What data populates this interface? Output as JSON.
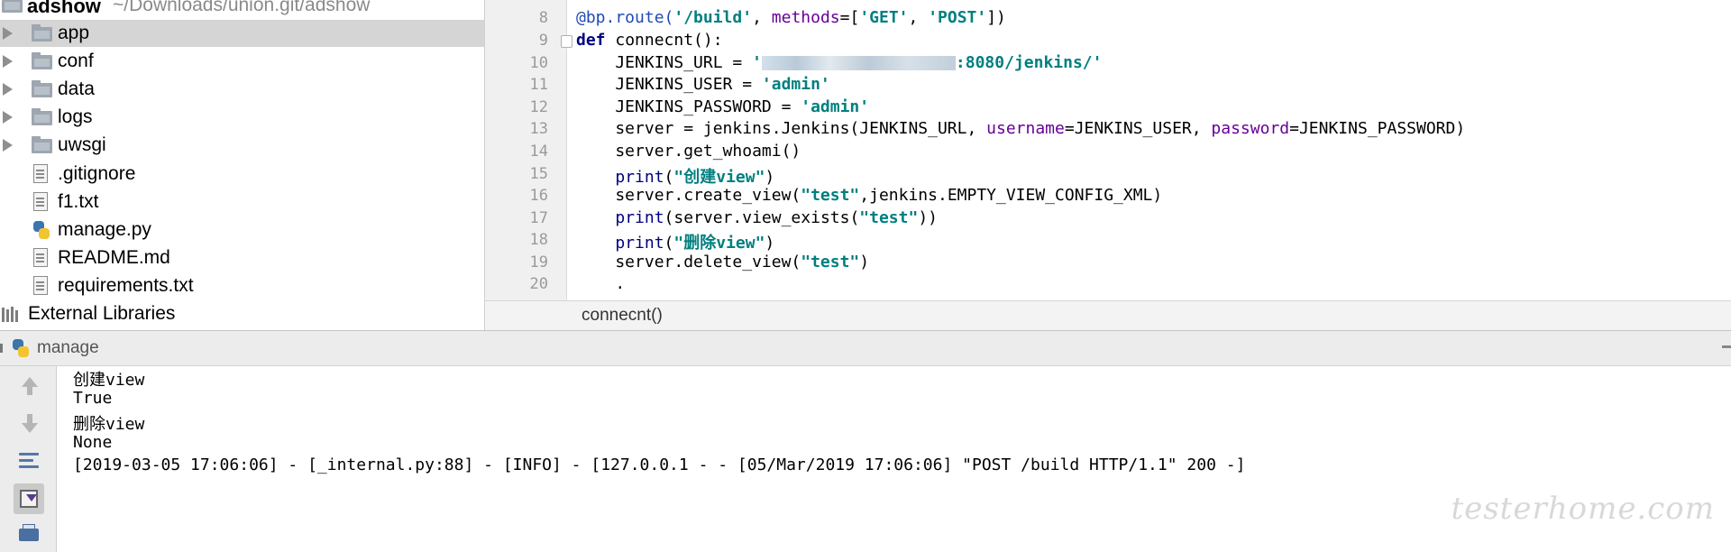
{
  "project": {
    "root_name": "adshow",
    "root_path": "~/Downloads/union.git/adshow",
    "items": [
      {
        "label": "app",
        "type": "folder",
        "selected": true
      },
      {
        "label": "conf",
        "type": "folder"
      },
      {
        "label": "data",
        "type": "folder"
      },
      {
        "label": "logs",
        "type": "folder"
      },
      {
        "label": "uwsgi",
        "type": "folder"
      },
      {
        "label": ".gitignore",
        "type": "file"
      },
      {
        "label": "f1.txt",
        "type": "file"
      },
      {
        "label": "manage.py",
        "type": "python-file"
      },
      {
        "label": "README.md",
        "type": "file"
      },
      {
        "label": "requirements.txt",
        "type": "file"
      }
    ],
    "external_libraries": "External Libraries"
  },
  "editor": {
    "line_numbers": [
      "8",
      "9",
      "10",
      "11",
      "12",
      "13",
      "14",
      "15",
      "16",
      "17",
      "18",
      "19",
      "20"
    ],
    "code": {
      "l8": {
        "a": "@bp.route(",
        "b": "'/build'",
        "c": ", ",
        "d": "methods",
        "e": "=[",
        "f": "'GET'",
        "g": ", ",
        "h": "'POST'",
        "i": "])"
      },
      "l9": {
        "kw": "def",
        "rest": " connecnt():"
      },
      "l10": {
        "a": "    JENKINS_URL = ",
        "q": "'",
        "tail": ":8080/jenkins/'"
      },
      "l11": {
        "a": "    JENKINS_USER = ",
        "s": "'admin'"
      },
      "l12": {
        "a": "    JENKINS_PASSWORD = ",
        "s": "'admin'"
      },
      "l13": {
        "a": "    server = jenkins.Jenkins(JENKINS_URL, ",
        "p1": "username",
        "b": "=JENKINS_USER, ",
        "p2": "password",
        "c": "=JENKINS_PASSWORD)"
      },
      "l14": {
        "a": "    server.get_whoami()"
      },
      "l15": {
        "a": "    ",
        "fn": "print",
        "b": "(",
        "s": "\"创建view\"",
        "c": ")"
      },
      "l16": {
        "a": "    server.create_view(",
        "s": "\"test\"",
        "b": ",jenkins.EMPTY_VIEW_CONFIG_XML)"
      },
      "l17": {
        "a": "    ",
        "fn": "print",
        "b": "(server.view_exists(",
        "s": "\"test\"",
        "c": "))"
      },
      "l18": {
        "a": "    ",
        "fn": "print",
        "b": "(",
        "s": "\"删除view\"",
        "c": ")"
      },
      "l19": {
        "a": "    server.delete_view(",
        "s": "\"test\"",
        "b": ")"
      },
      "l20": {
        "a": "    ."
      }
    },
    "breadcrumb": "connecnt()"
  },
  "run_panel": {
    "title": "manage",
    "output": [
      "创建view",
      "True",
      "删除view",
      "None",
      "[2019-03-05 17:06:06] - [_internal.py:88] - [INFO] - [127.0.0.1 - - [05/Mar/2019 17:06:06] \"POST /build HTTP/1.1\" 200 -]"
    ]
  },
  "watermark": "testerhome.com"
}
